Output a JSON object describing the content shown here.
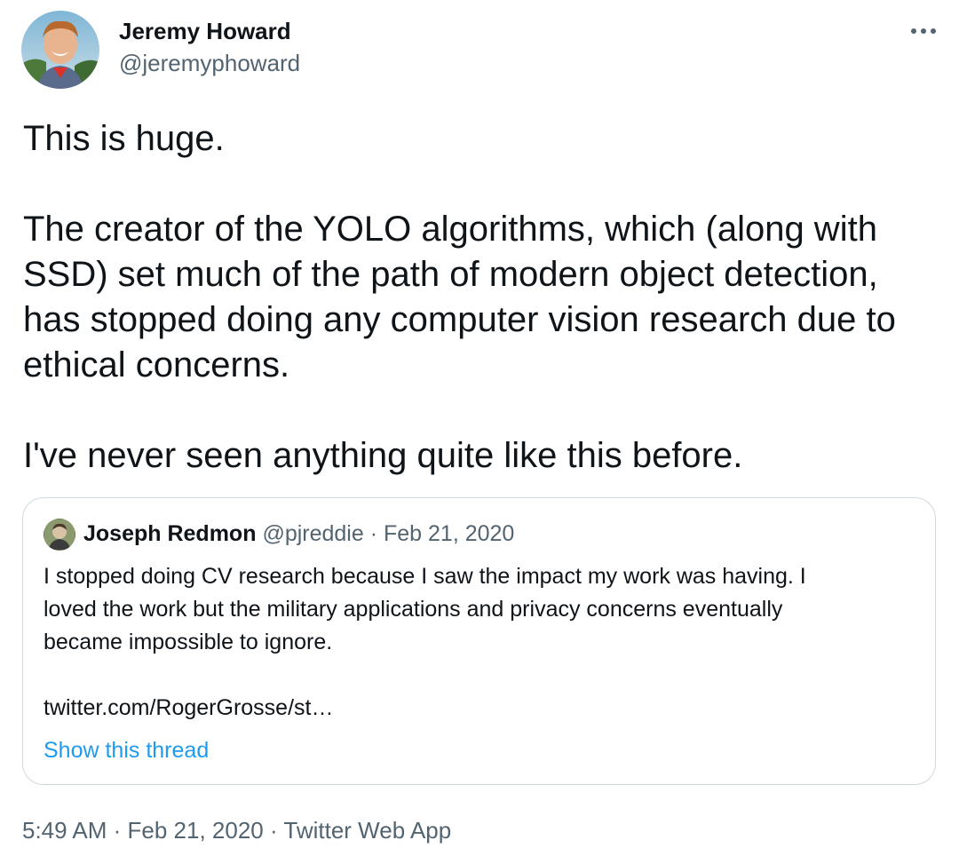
{
  "author": {
    "name": "Jeremy Howard",
    "handle": "@jeremyphoward",
    "avatar_icon": "profile-photo"
  },
  "more_icon": "more-horizontal-icon",
  "more_glyph": "···",
  "tweet": {
    "lines": [
      "This is huge.",
      "",
      "The creator of the YOLO algorithms, which (along with",
      "SSD) set much of the path of modern object detection,",
      "has stopped doing any computer vision research due to",
      "ethical concerns.",
      "",
      "I've never seen anything quite like this before."
    ]
  },
  "quote": {
    "name": "Joseph Redmon",
    "handle": "@pjreddie",
    "separator": " · ",
    "date": "Feb 21, 2020",
    "lines": [
      "I stopped doing CV research because I saw the impact my work was having. I",
      "loved the work but the military applications and privacy concerns eventually",
      "became impossible to ignore.",
      "",
      "twitter.com/RogerGrosse/st…"
    ],
    "show_thread": "Show this thread"
  },
  "footer": {
    "time": "5:49 AM",
    "separator": " · ",
    "date": "Feb 21, 2020",
    "source": "Twitter Web App"
  },
  "colors": {
    "text": "#0f1419",
    "secondary": "#536471",
    "link": "#1d9bf0",
    "border": "#cfd9de"
  }
}
